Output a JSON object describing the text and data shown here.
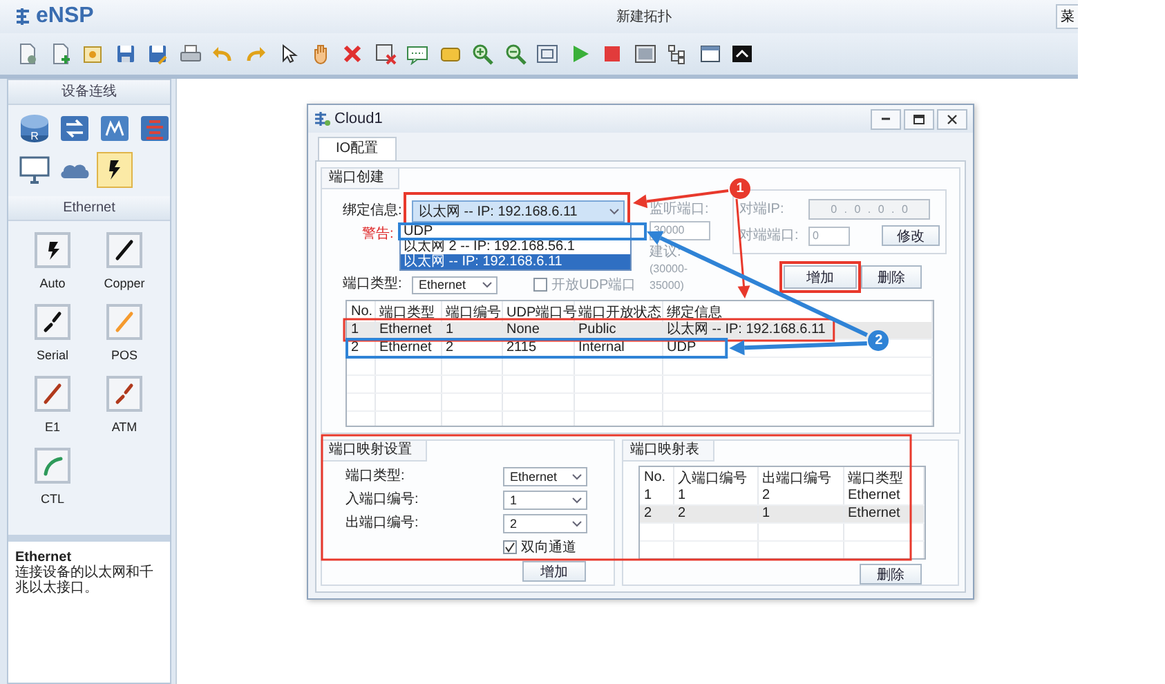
{
  "app": {
    "logo": "eNSP",
    "title": "新建拓扑",
    "menu_button": "菜"
  },
  "sidebar": {
    "device_header": "设备连线",
    "devices": [
      {
        "kind": "router",
        "mark": "R",
        "selected": false
      },
      {
        "kind": "switch",
        "selected": false
      },
      {
        "kind": "wireless",
        "selected": false
      },
      {
        "kind": "firewall",
        "selected": false
      },
      {
        "kind": "pc",
        "selected": false
      },
      {
        "kind": "cloud",
        "selected": false
      },
      {
        "kind": "cable",
        "selected": true
      }
    ],
    "cable_header": "Ethernet",
    "cables": [
      {
        "label": "Auto",
        "kind": "auto",
        "color": "#111111"
      },
      {
        "label": "Copper",
        "kind": "solid",
        "color": "#111111"
      },
      {
        "label": "Serial",
        "kind": "broken",
        "color": "#111111"
      },
      {
        "label": "POS",
        "kind": "solid",
        "color": "#f59a2e"
      },
      {
        "label": "E1",
        "kind": "solid",
        "color": "#b0391c"
      },
      {
        "label": "ATM",
        "kind": "broken",
        "color": "#b0391c"
      },
      {
        "label": "CTL",
        "kind": "curve",
        "color": "#2e9a5a"
      }
    ],
    "info": {
      "title": "Ethernet",
      "text": "连接设备的以太网和千兆以太接口。"
    }
  },
  "dialog": {
    "title": "Cloud1",
    "tabs": [
      {
        "label": "IO配置",
        "selected": true
      }
    ],
    "port_create": {
      "title": "端口创建",
      "bind_label": "绑定信息:",
      "bind_value": "以太网 -- IP: 192.168.6.11",
      "warning_label": "警告:",
      "dropdown_options": [
        {
          "label": "UDP",
          "selected": false
        },
        {
          "label": "以太网 2 -- IP: 192.168.56.1",
          "selected": false
        },
        {
          "label": "以太网 -- IP: 192.168.6.11",
          "selected": true
        }
      ],
      "port_type_label": "端口类型:",
      "port_type_value": "Ethernet",
      "udp_checkbox": {
        "label": "开放UDP端口",
        "checked": false
      },
      "listen": {
        "label": "监听端口:",
        "value": "30000",
        "hint": "建议:",
        "range": "(30000-35000)",
        "disabled": true
      },
      "peer": {
        "ip_label": "对端IP:",
        "ip": "0 . 0 . 0 . 0",
        "port_label": "对端端口:",
        "port": "0",
        "modify_button": "修改",
        "disabled": true
      },
      "add_button": "增加",
      "delete_button": "删除",
      "table": {
        "columns": [
          "No.",
          "端口类型",
          "端口编号",
          "UDP端口号",
          "端口开放状态",
          "绑定信息"
        ],
        "rows": [
          {
            "cells": [
              "1",
              "Ethernet",
              "1",
              "None",
              "Public",
              "以太网 -- IP: 192.168.6.11"
            ],
            "selected": true
          },
          {
            "cells": [
              "2",
              "Ethernet",
              "2",
              "2115",
              "Internal",
              "UDP"
            ],
            "selected": false
          }
        ]
      }
    },
    "port_mapping": {
      "title": "端口映射设置",
      "fields": [
        {
          "label": "端口类型:",
          "value": "Ethernet"
        },
        {
          "label": "入端口编号:",
          "value": "1"
        },
        {
          "label": "出端口编号:",
          "value": "2"
        }
      ],
      "bidirectional": {
        "label": "双向通道",
        "checked": true
      },
      "add_button": "增加"
    },
    "mapping_table": {
      "title": "端口映射表",
      "columns": [
        "No.",
        "入端口编号",
        "出端口编号",
        "端口类型"
      ],
      "rows": [
        {
          "cells": [
            "1",
            "1",
            "2",
            "Ethernet"
          ],
          "selected": false
        },
        {
          "cells": [
            "2",
            "2",
            "1",
            "Ethernet"
          ],
          "selected": true
        }
      ],
      "delete_button": "删除"
    }
  },
  "annotations": {
    "badges": [
      {
        "label": "1",
        "color": "#e8392c"
      },
      {
        "label": "2",
        "color": "#2f83d6"
      }
    ]
  }
}
